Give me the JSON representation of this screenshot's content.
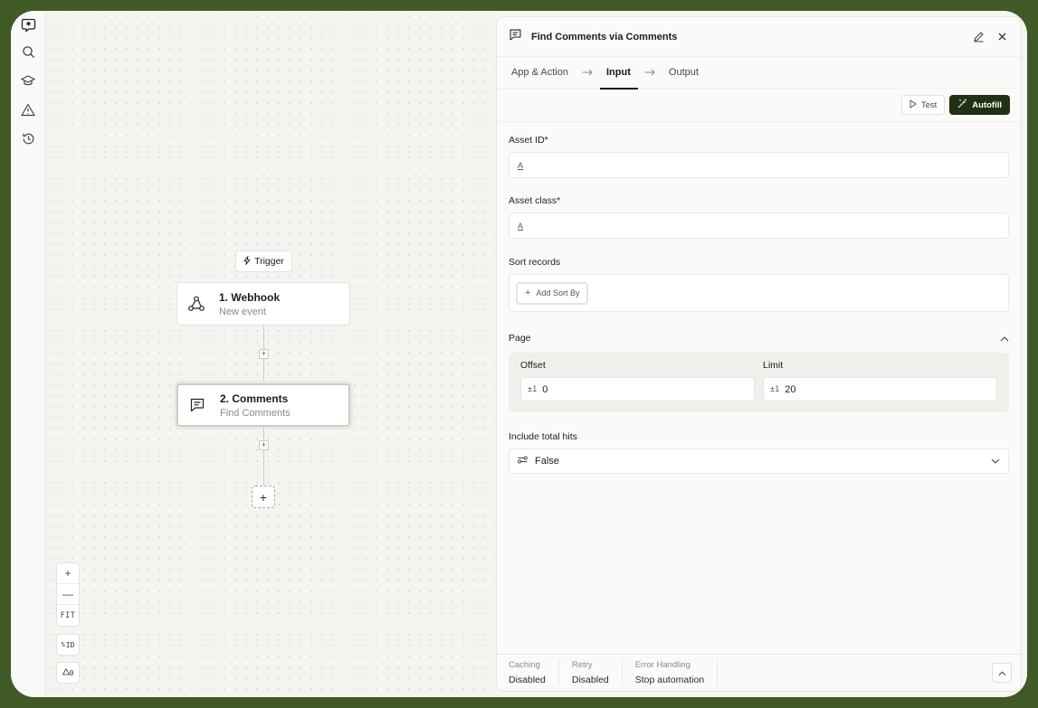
{
  "sidebar": {
    "icons": [
      "logo-icon",
      "search-icon",
      "graduation-cap-icon",
      "warning-icon",
      "history-icon"
    ]
  },
  "canvas": {
    "trigger_label": "Trigger",
    "nodes": [
      {
        "title": "1. Webhook",
        "subtitle": "New event",
        "icon": "webhook-icon"
      },
      {
        "title": "2. Comments",
        "subtitle": "Find Comments",
        "icon": "comment-icon"
      }
    ],
    "zoom_in": "+",
    "zoom_out": "—",
    "fit_label": "FIT",
    "id_toggle_label": "ID",
    "warnings_count": "0"
  },
  "panel": {
    "title": "Find Comments via Comments",
    "tabs": [
      {
        "label": "App & Action",
        "active": false
      },
      {
        "label": "Input",
        "active": true
      },
      {
        "label": "Output",
        "active": false
      }
    ],
    "test_label": "Test",
    "autofill_label": "Autofill",
    "fields": {
      "asset_id_label": "Asset ID*",
      "asset_id_value": "",
      "asset_class_label": "Asset class*",
      "asset_class_value": "",
      "sort_records_label": "Sort records",
      "add_sort_label": "Add Sort By",
      "page_label": "Page",
      "offset_label": "Offset",
      "offset_value": "0",
      "limit_label": "Limit",
      "limit_value": "20",
      "include_total_hits_label": "Include total hits",
      "include_total_hits_value": "False",
      "number_prefix": "±1",
      "text_prefix": "A"
    },
    "footer": [
      {
        "label": "Caching",
        "value": "Disabled"
      },
      {
        "label": "Retry",
        "value": "Disabled"
      },
      {
        "label": "Error Handling",
        "value": "Stop automation"
      }
    ]
  },
  "colors": {
    "background": "#3f5a26",
    "accent": "#1f3214"
  }
}
